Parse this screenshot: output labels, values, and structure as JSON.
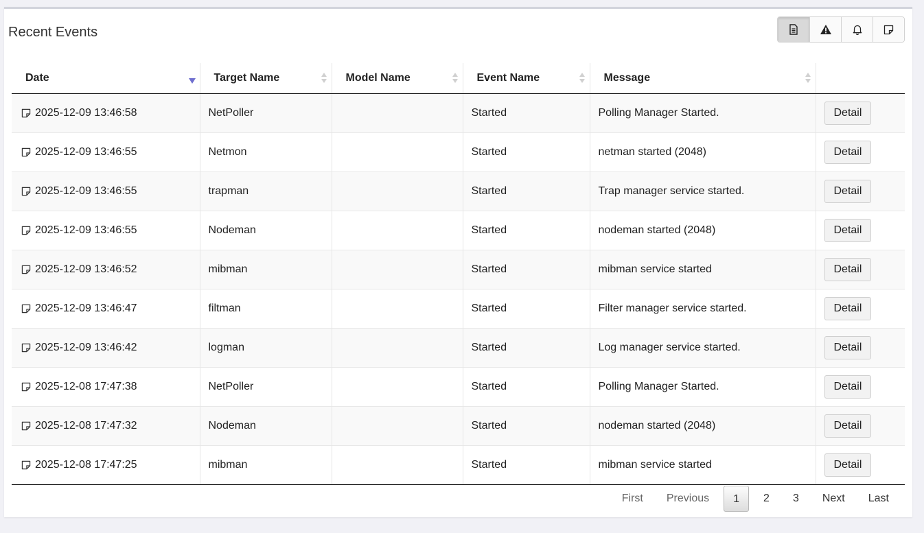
{
  "panel": {
    "title": "Recent Events",
    "view_buttons": [
      {
        "icon": "document-icon",
        "active": true
      },
      {
        "icon": "warning-icon",
        "active": false
      },
      {
        "icon": "bell-icon",
        "active": false
      },
      {
        "icon": "note-icon",
        "active": false
      }
    ]
  },
  "table": {
    "columns": [
      "Date",
      "Target Name",
      "Model Name",
      "Event Name",
      "Message",
      ""
    ],
    "sorted_column": "Date",
    "sort_direction": "descending",
    "row_icon": "note-icon",
    "action_label": "Detail",
    "rows": [
      {
        "date": "2025-12-09 13:46:58",
        "target": "NetPoller",
        "model": "",
        "event": "Started",
        "message": "Polling Manager Started."
      },
      {
        "date": "2025-12-09 13:46:55",
        "target": "Netmon",
        "model": "",
        "event": "Started",
        "message": "netman started (2048)"
      },
      {
        "date": "2025-12-09 13:46:55",
        "target": "trapman",
        "model": "",
        "event": "Started",
        "message": "Trap manager service started."
      },
      {
        "date": "2025-12-09 13:46:55",
        "target": "Nodeman",
        "model": "",
        "event": "Started",
        "message": "nodeman started (2048)"
      },
      {
        "date": "2025-12-09 13:46:52",
        "target": "mibman",
        "model": "",
        "event": "Started",
        "message": "mibman service started"
      },
      {
        "date": "2025-12-09 13:46:47",
        "target": "filtman",
        "model": "",
        "event": "Started",
        "message": "Filter manager service started."
      },
      {
        "date": "2025-12-09 13:46:42",
        "target": "logman",
        "model": "",
        "event": "Started",
        "message": "Log manager service started."
      },
      {
        "date": "2025-12-08 17:47:38",
        "target": "NetPoller",
        "model": "",
        "event": "Started",
        "message": "Polling Manager Started."
      },
      {
        "date": "2025-12-08 17:47:32",
        "target": "Nodeman",
        "model": "",
        "event": "Started",
        "message": "nodeman started (2048)"
      },
      {
        "date": "2025-12-08 17:47:25",
        "target": "mibman",
        "model": "",
        "event": "Started",
        "message": "mibman service started"
      }
    ]
  },
  "pagination": {
    "first": "First",
    "previous": "Previous",
    "pages": [
      "1",
      "2",
      "3"
    ],
    "current": "1",
    "next": "Next",
    "last": "Last"
  }
}
